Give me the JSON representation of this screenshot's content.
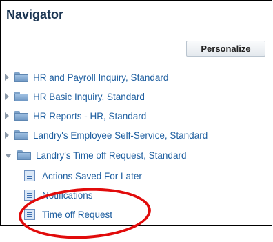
{
  "navigator": {
    "title": "Navigator",
    "personalize_label": "Personalize",
    "items": [
      {
        "label": "HR and Payroll Inquiry, Standard",
        "expanded": false
      },
      {
        "label": "HR Basic Inquiry, Standard",
        "expanded": false
      },
      {
        "label": "HR Reports - HR, Standard",
        "expanded": false
      },
      {
        "label": "Landry's Employee Self-Service, Standard",
        "expanded": false
      },
      {
        "label": "Landry's Time off Request, Standard",
        "expanded": true,
        "children": [
          {
            "label": "Actions Saved For Later"
          },
          {
            "label": "Notifications"
          },
          {
            "label": "Time off Request"
          }
        ]
      }
    ]
  },
  "annotation": {
    "color": "#e10b0b",
    "highlight_target": "Time off Request"
  }
}
